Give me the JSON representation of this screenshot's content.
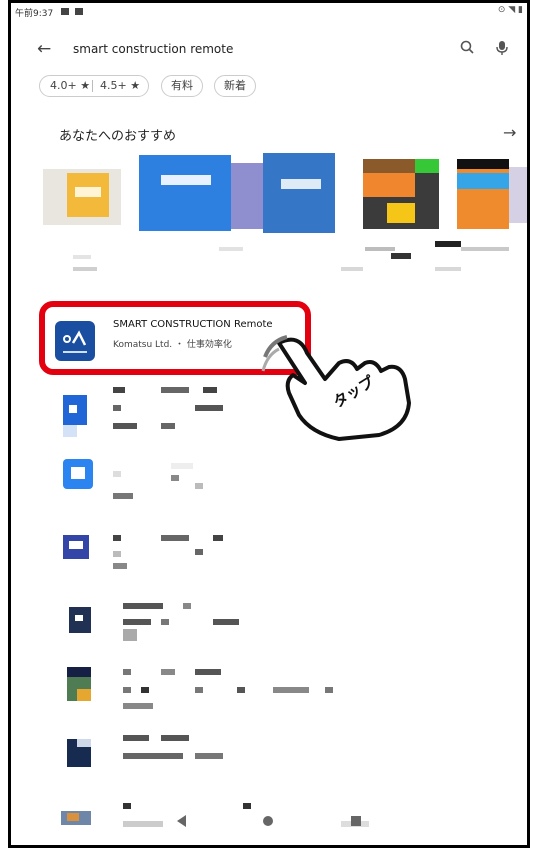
{
  "status_bar": {
    "time": "午前9:37"
  },
  "search": {
    "query": "smart construction remote"
  },
  "filters": {
    "rating1": "4.0+ ★",
    "rating2": "4.5+ ★",
    "paid": "有料",
    "new": "新着"
  },
  "recommended": {
    "title": "あなたへのおすすめ"
  },
  "app": {
    "name": "SMART CONSTRUCTION Remote",
    "developer": "Komatsu Ltd. ・ 仕事効率化"
  },
  "annotation": {
    "tap": "タップ"
  },
  "colors": {
    "highlight": "#e3000f",
    "app_icon_bg": "#1a4ea0"
  }
}
